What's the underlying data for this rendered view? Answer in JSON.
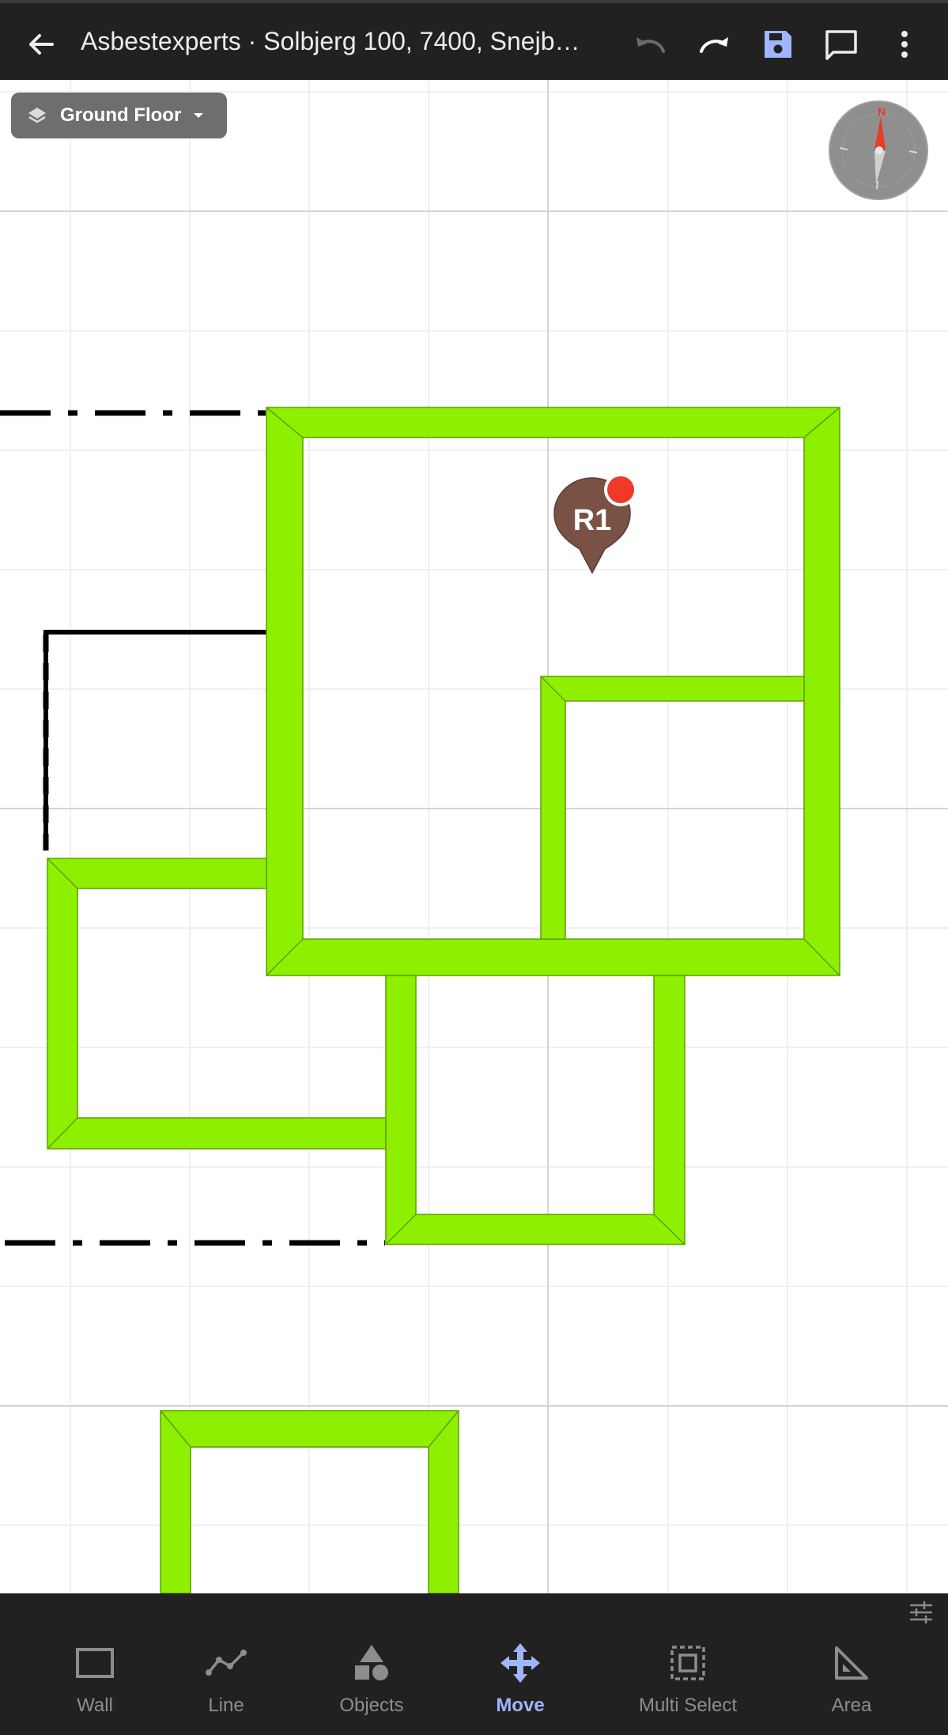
{
  "header": {
    "title": "Asbestexperts · Solbjerg 100, 7400, Snejb…",
    "back_icon": "arrow-left-icon",
    "actions": [
      "undo-icon",
      "redo-icon",
      "save-icon",
      "comment-icon",
      "more-vertical-icon"
    ]
  },
  "canvas": {
    "floor_selector": {
      "label": "Ground Floor"
    },
    "compass": {
      "north_label": "N"
    },
    "room_marker": {
      "label": "R1"
    },
    "colors": {
      "wall": "#8fef00",
      "wall_edge": "#5aa000",
      "marker": "#7a5145",
      "notify_dot": "#f0392b",
      "grid": "#e8e8e8",
      "grid_major": "#d2d2d2"
    }
  },
  "toolbar": {
    "tools": [
      {
        "label": "Wall",
        "icon": "wall-rectangle-icon",
        "active": false
      },
      {
        "label": "Line",
        "icon": "polyline-icon",
        "active": false
      },
      {
        "label": "Objects",
        "icon": "shapes-icon",
        "active": false
      },
      {
        "label": "Move",
        "icon": "move-arrows-icon",
        "active": true
      },
      {
        "label": "Multi Select",
        "icon": "multi-select-icon",
        "active": false
      },
      {
        "label": "Area",
        "icon": "set-square-icon",
        "active": false
      }
    ],
    "accent": "#9fb6ff"
  }
}
